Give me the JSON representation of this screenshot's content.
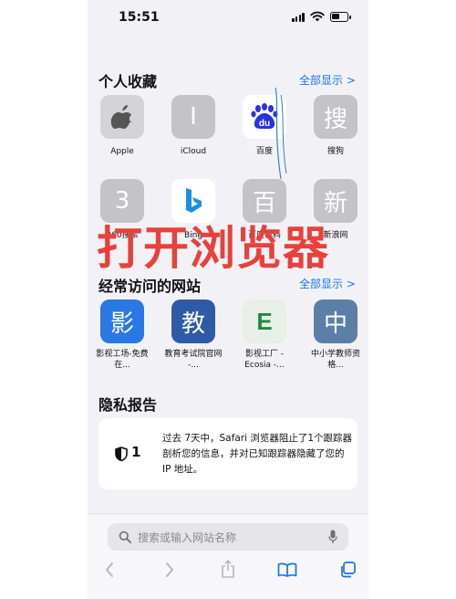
{
  "status": {
    "time": "15:51"
  },
  "favorites": {
    "title": "个人收藏",
    "show_all": "全部显示 >",
    "items": [
      {
        "label": "Apple",
        "glyph": "",
        "color": "#d4d4d8"
      },
      {
        "label": "iCloud",
        "glyph": "I",
        "color": "#c3c3c8"
      },
      {
        "label": "百度",
        "glyph": "du",
        "color": "#ffffff"
      },
      {
        "label": "搜狗",
        "glyph": "搜",
        "color": "#c3c3c8"
      },
      {
        "label": "360搜索",
        "glyph": "3",
        "color": "#c3c3c8"
      },
      {
        "label": "Bing",
        "glyph": "b",
        "color": "#ffffff"
      },
      {
        "label": "百度百科",
        "glyph": "百",
        "color": "#c3c3c8"
      },
      {
        "label": "新浪网",
        "glyph": "新",
        "color": "#c3c3c8"
      }
    ]
  },
  "frequent": {
    "title": "经常访问的网站",
    "show_all": "全部显示 >",
    "items": [
      {
        "label": "影视工场-免费在...",
        "glyph": "影",
        "color": "#2b78e4"
      },
      {
        "label": "教育考试院官网 -...",
        "glyph": "教",
        "color": "#2e5ba8"
      },
      {
        "label": "影视工厂 - Ecosia -...",
        "glyph": "E",
        "color": "#e8efe6"
      },
      {
        "label": "中小学教师资格...",
        "glyph": "中",
        "color": "#5b7fa8"
      }
    ]
  },
  "privacy": {
    "title": "隐私报告",
    "count": "1",
    "text": "过去 7天中，Safari 浏览器阻止了1个跟踪器剖析您的信息，并对已知跟踪器隐藏了您的 IP 地址。"
  },
  "search": {
    "placeholder": "搜索或输入网站名称"
  },
  "overlay_text": "打开浏览器"
}
